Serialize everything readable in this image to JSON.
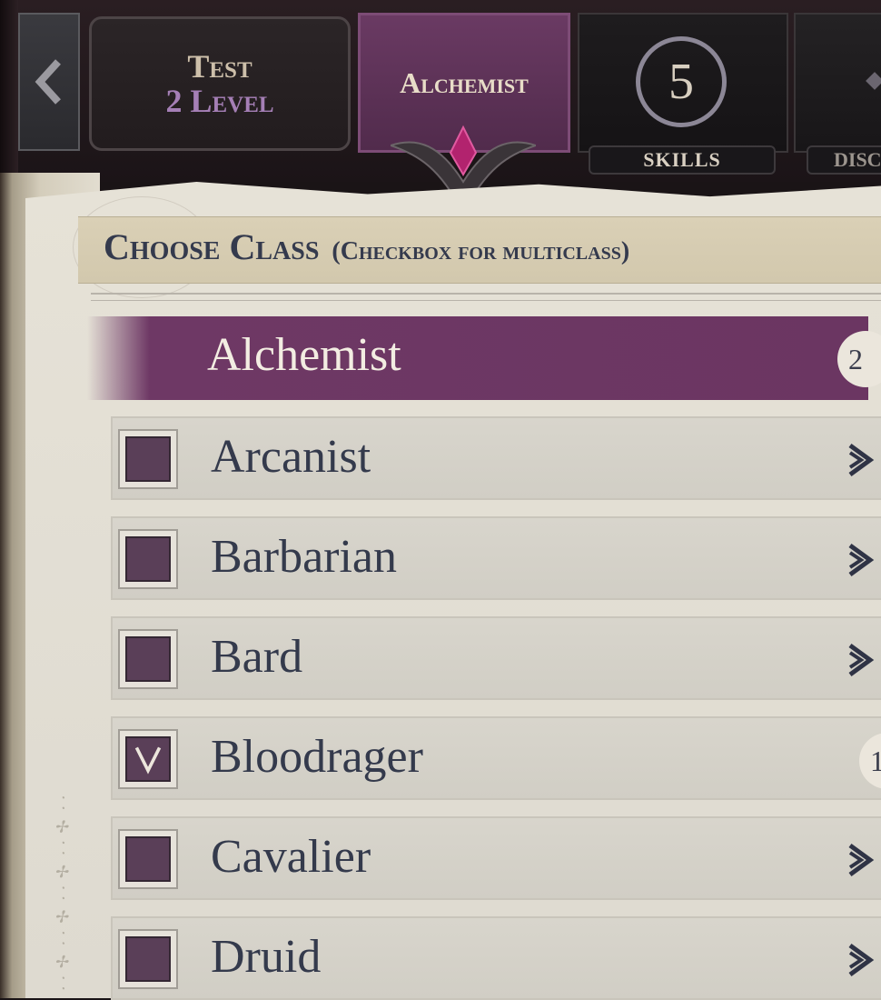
{
  "header": {
    "level_tab": {
      "line1": "Test",
      "line2": "2 Level"
    },
    "class_tab": {
      "label": "Alchemist"
    },
    "skills": {
      "count": "5",
      "label": "SKILLS"
    },
    "next_tab_label": "DISC"
  },
  "panel": {
    "title": "Choose Class",
    "subtitle": "(Checkbox for multiclass)"
  },
  "classes": [
    {
      "name": "Alchemist",
      "selected": true,
      "checked": false,
      "level": "2"
    },
    {
      "name": "Arcanist",
      "selected": false,
      "checked": false
    },
    {
      "name": "Barbarian",
      "selected": false,
      "checked": false
    },
    {
      "name": "Bard",
      "selected": false,
      "checked": false
    },
    {
      "name": "Bloodrager",
      "selected": false,
      "checked": true,
      "level": "1"
    },
    {
      "name": "Cavalier",
      "selected": false,
      "checked": false
    },
    {
      "name": "Druid",
      "selected": false,
      "checked": false
    }
  ],
  "colors": {
    "accent_purple": "#6b3662",
    "parchment": "#e2ddd2",
    "ink": "#343a4c"
  }
}
